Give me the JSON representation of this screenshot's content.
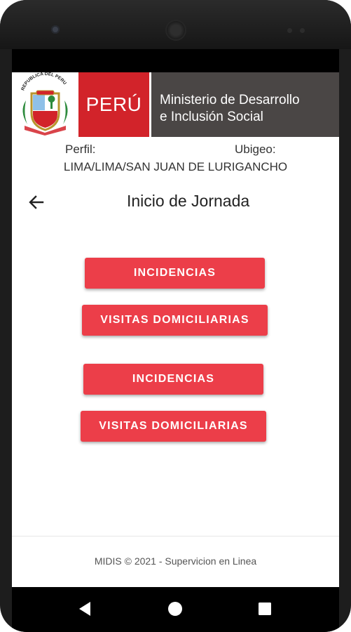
{
  "header": {
    "brand_text": "PERÚ",
    "ministry_line1": "Ministerio de  Desarrollo",
    "ministry_line2": "e  Inclusión Social",
    "crest_text": "REPUBLICA DEL PERU",
    "colors": {
      "brand_red": "#d2232a",
      "ministry_gray": "#4a4645"
    }
  },
  "profile": {
    "perfil_label": "Perfil:",
    "ubigeo_label": "Ubigeo:",
    "location": "LIMA/LIMA/SAN JUAN DE LURIGANCHO"
  },
  "page": {
    "title": "Inicio de Jornada",
    "back_icon": "arrow-left-icon"
  },
  "buttons": [
    {
      "label": "INCIDENCIAS"
    },
    {
      "label": "VISITAS DOMICILIARIAS"
    },
    {
      "label": "INCIDENCIAS"
    },
    {
      "label": "VISITAS DOMICILIARIAS"
    }
  ],
  "button_color": "#ec3e49",
  "footer": {
    "text": "MIDIS © 2021 - Supervicion en Linea"
  },
  "system_nav": {
    "back_icon": "triangle-back-icon",
    "home_icon": "circle-home-icon",
    "recents_icon": "square-recents-icon"
  }
}
